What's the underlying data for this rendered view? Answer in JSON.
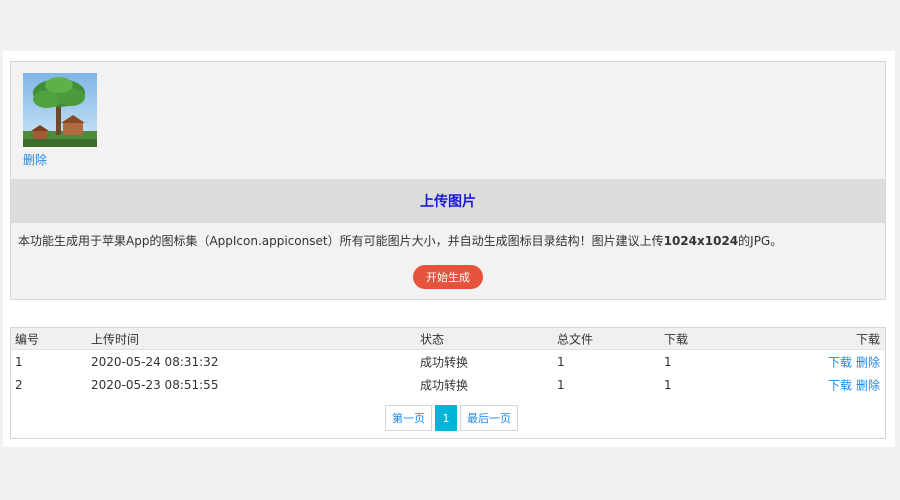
{
  "upload": {
    "thumbnail_delete": "删除",
    "upload_label": "上传图片",
    "description_pre": "本功能生成用于苹果App的图标集（AppIcon.appiconset）所有可能图片大小，并自动生成图标目录结构！图片建议上传",
    "description_size": "1024x1024",
    "description_post": "的JPG。",
    "start_button": "开始生成"
  },
  "table": {
    "headers": [
      "编号",
      "上传时间",
      "状态",
      "总文件",
      "下载",
      "下载"
    ],
    "rows": [
      {
        "id": "1",
        "time": "2020-05-24 08:31:32",
        "status": "成功转换",
        "total": "1",
        "downloads": "1",
        "download_link": "下载",
        "delete_link": "删除"
      },
      {
        "id": "2",
        "time": "2020-05-23 08:51:55",
        "status": "成功转换",
        "total": "1",
        "downloads": "1",
        "download_link": "下载",
        "delete_link": "删除"
      }
    ]
  },
  "pagination": {
    "first": "第一页",
    "current": "1",
    "last": "最后一页"
  },
  "colors": {
    "accent_link": "#1e88e5",
    "upload_title": "#1a1ad6",
    "start_button": "#e5533d",
    "active_page": "#00b4d8"
  }
}
